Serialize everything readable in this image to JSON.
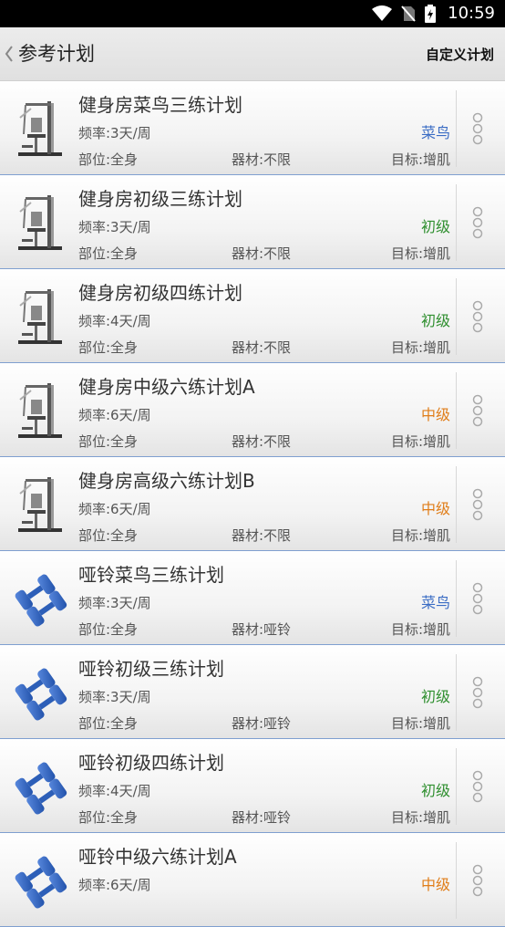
{
  "status": {
    "time": "10:59"
  },
  "header": {
    "title": "参考计划",
    "action": "自定义计划"
  },
  "plans": [
    {
      "title": "健身房菜鸟三练计划",
      "freq": "频率:3天/周",
      "level": "菜鸟",
      "level_color": "#3a6cc4",
      "part": "部位:全身",
      "equip": "器材:不限",
      "goal": "目标:增肌",
      "icon": "gym-machine-icon"
    },
    {
      "title": "健身房初级三练计划",
      "freq": "频率:3天/周",
      "level": "初级",
      "level_color": "#2f8f2f",
      "part": "部位:全身",
      "equip": "器材:不限",
      "goal": "目标:增肌",
      "icon": "gym-machine-icon"
    },
    {
      "title": "健身房初级四练计划",
      "freq": "频率:4天/周",
      "level": "初级",
      "level_color": "#2f8f2f",
      "part": "部位:全身",
      "equip": "器材:不限",
      "goal": "目标:增肌",
      "icon": "gym-machine-icon"
    },
    {
      "title": "健身房中级六练计划A",
      "freq": "频率:6天/周",
      "level": "中级",
      "level_color": "#e07e1a",
      "part": "部位:全身",
      "equip": "器材:不限",
      "goal": "目标:增肌",
      "icon": "gym-machine-icon"
    },
    {
      "title": "健身房高级六练计划B",
      "freq": "频率:6天/周",
      "level": "中级",
      "level_color": "#e07e1a",
      "part": "部位:全身",
      "equip": "器材:不限",
      "goal": "目标:增肌",
      "icon": "gym-machine-icon"
    },
    {
      "title": "哑铃菜鸟三练计划",
      "freq": "频率:3天/周",
      "level": "菜鸟",
      "level_color": "#3a6cc4",
      "part": "部位:全身",
      "equip": "器材:哑铃",
      "goal": "目标:增肌",
      "icon": "dumbbell-icon"
    },
    {
      "title": "哑铃初级三练计划",
      "freq": "频率:3天/周",
      "level": "初级",
      "level_color": "#2f8f2f",
      "part": "部位:全身",
      "equip": "器材:哑铃",
      "goal": "目标:增肌",
      "icon": "dumbbell-icon"
    },
    {
      "title": "哑铃初级四练计划",
      "freq": "频率:4天/周",
      "level": "初级",
      "level_color": "#2f8f2f",
      "part": "部位:全身",
      "equip": "器材:哑铃",
      "goal": "目标:增肌",
      "icon": "dumbbell-icon"
    },
    {
      "title": "哑铃中级六练计划A",
      "freq": "频率:6天/周",
      "level": "中级",
      "level_color": "#e07e1a",
      "part": "",
      "equip": "",
      "goal": "",
      "icon": "dumbbell-icon"
    }
  ]
}
